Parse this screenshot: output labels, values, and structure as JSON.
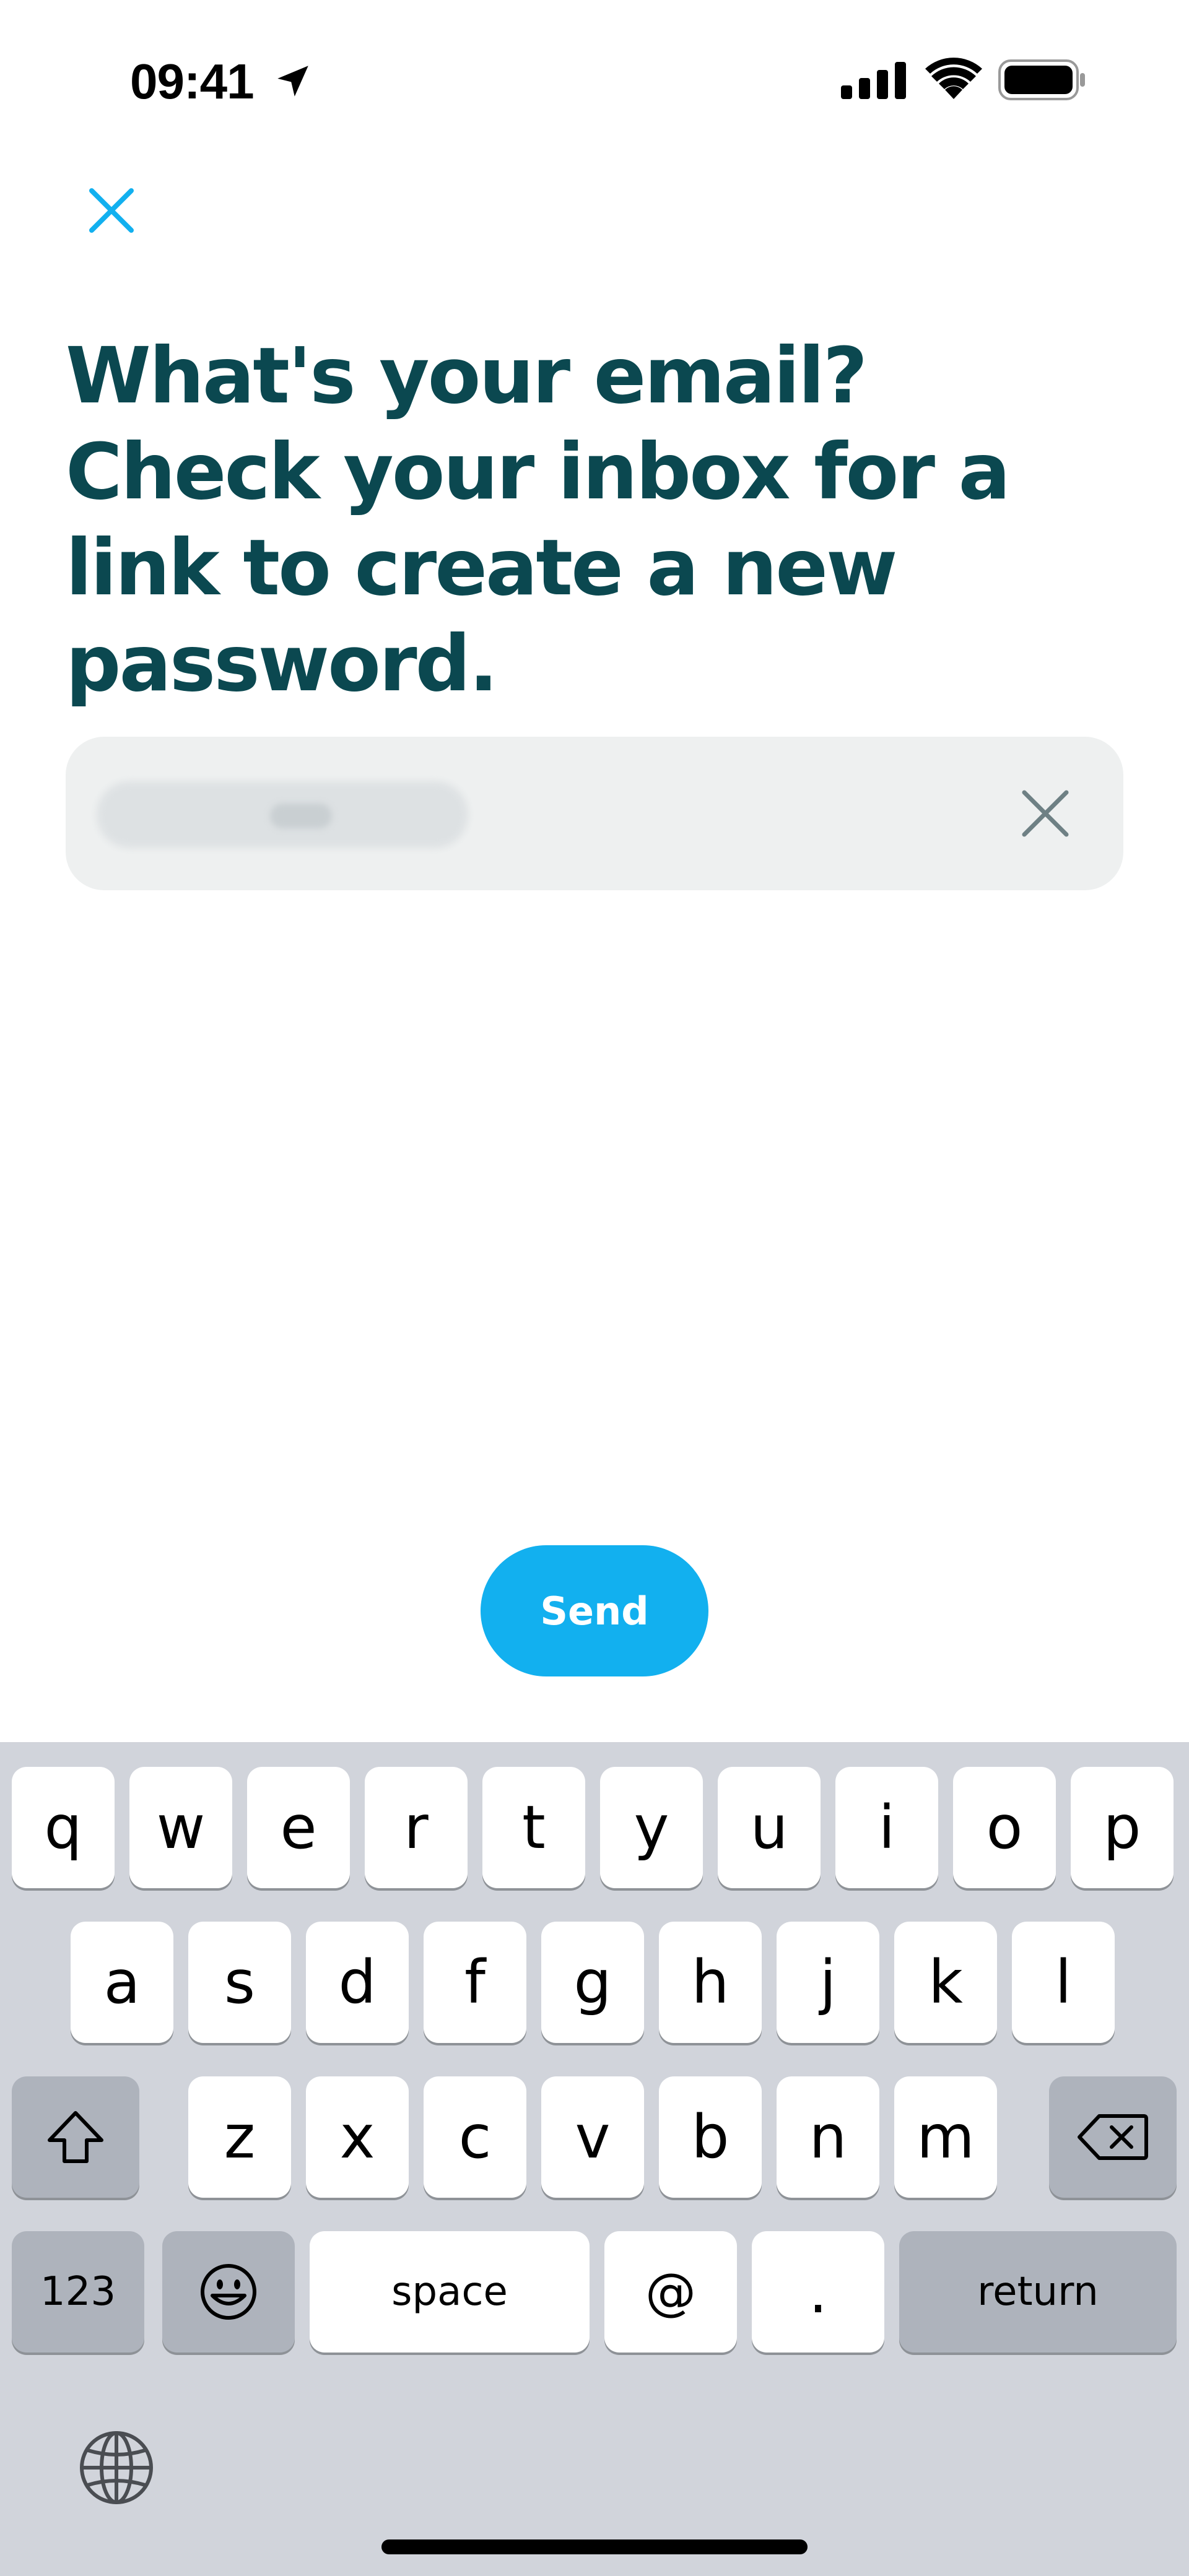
{
  "status_bar": {
    "time": "09:41"
  },
  "heading": "What's your email? Check your inbox for a link to create a new password.",
  "email_field": {
    "value": ""
  },
  "send_label": "Send",
  "keyboard": {
    "row1": [
      "q",
      "w",
      "e",
      "r",
      "t",
      "y",
      "u",
      "i",
      "o",
      "p"
    ],
    "row2": [
      "a",
      "s",
      "d",
      "f",
      "g",
      "h",
      "j",
      "k",
      "l"
    ],
    "row3": [
      "z",
      "x",
      "c",
      "v",
      "b",
      "n",
      "m"
    ],
    "numbers_label": "123",
    "space_label": "space",
    "at_label": "@",
    "dot_label": ".",
    "return_label": "return"
  },
  "colors": {
    "accent": "#12b0ef",
    "heading": "#0b4850",
    "keyboard_bg": "#d1d4db"
  }
}
